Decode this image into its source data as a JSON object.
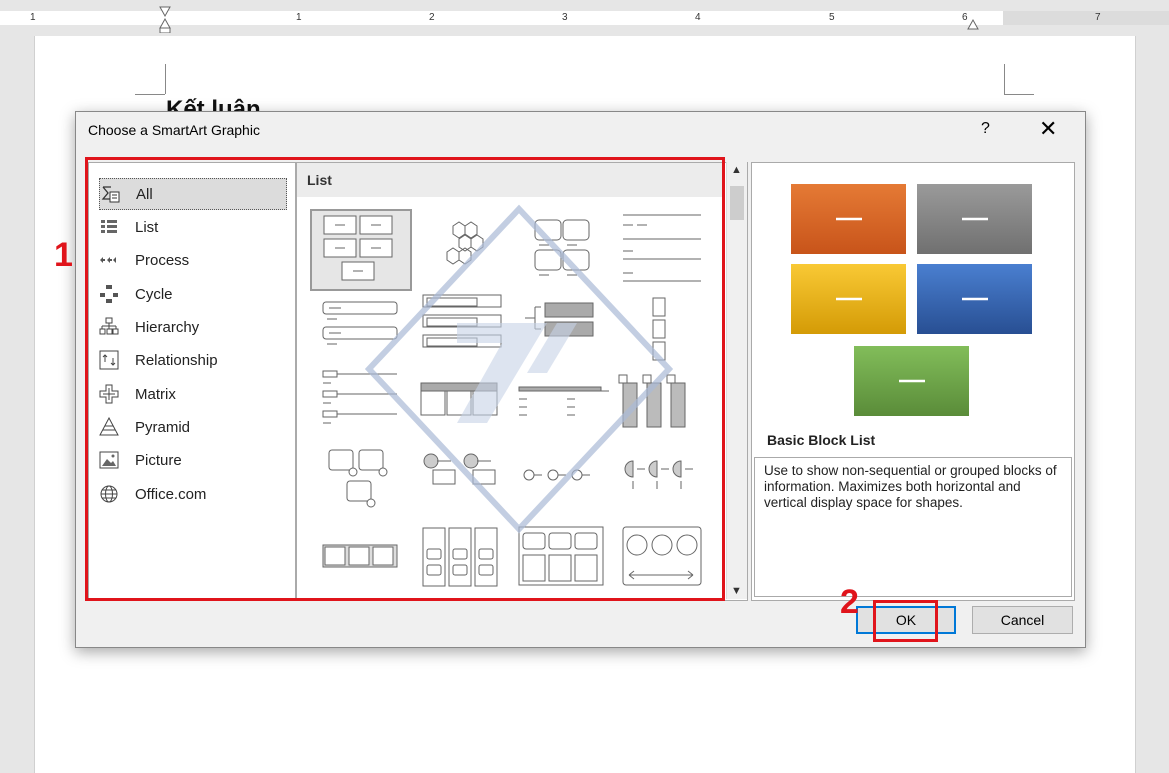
{
  "ruler": {
    "numbers": [
      "1",
      "1",
      "2",
      "3",
      "4",
      "5",
      "6",
      "7"
    ]
  },
  "document": {
    "heading_partial": "Kết luận"
  },
  "dialog": {
    "title": "Choose a SmartArt Graphic",
    "help": "?",
    "close": "✕",
    "categories": [
      {
        "label": "All",
        "icon": "all-icon",
        "selected": true
      },
      {
        "label": "List",
        "icon": "list-icon"
      },
      {
        "label": "Process",
        "icon": "process-icon"
      },
      {
        "label": "Cycle",
        "icon": "cycle-icon"
      },
      {
        "label": "Hierarchy",
        "icon": "hierarchy-icon"
      },
      {
        "label": "Relationship",
        "icon": "relationship-icon"
      },
      {
        "label": "Matrix",
        "icon": "matrix-icon"
      },
      {
        "label": "Pyramid",
        "icon": "pyramid-icon"
      },
      {
        "label": "Picture",
        "icon": "picture-icon"
      },
      {
        "label": "Office.com",
        "icon": "globe-icon"
      }
    ],
    "gallery_header": "List",
    "preview": {
      "colors": [
        "#e57a35",
        "#8c8c8c",
        "#f4b417",
        "#3a6bb5",
        "#71a84b"
      ],
      "title": "Basic Block List",
      "description": "Use to show non-sequential or grouped blocks of information. Maximizes both horizontal and vertical display space for shapes."
    },
    "ok_label": "OK",
    "cancel_label": "Cancel"
  },
  "annotations": {
    "marker1": "1",
    "marker2": "2",
    "accent": "#e0141b"
  }
}
